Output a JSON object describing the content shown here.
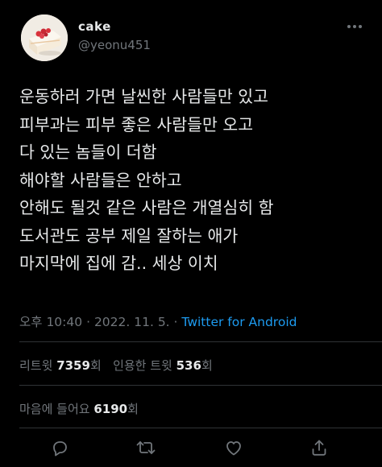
{
  "user": {
    "display_name": "cake",
    "handle": "@yeonu451"
  },
  "tweet": {
    "lines": [
      "운동하러 가면 날씬한 사람들만 있고",
      "피부과는 피부 좋은 사람들만 오고",
      "다 있는 놈들이 더함",
      "해야할 사람들은 안하고",
      "안해도 될것 같은 사람은 개열심히 함",
      "도서관도 공부 제일 잘하는 애가",
      "마지막에 집에 감.. 세상 이치"
    ]
  },
  "meta": {
    "time": "오후 10:40",
    "date": "2022. 11. 5.",
    "separator": "·",
    "source": "Twitter for Android"
  },
  "stats": {
    "retweet_label": "리트윗",
    "retweet_count": "7359",
    "retweet_unit": "회",
    "quote_label": "인용한 트윗",
    "quote_count": "536",
    "quote_unit": "회",
    "like_label": "마음에 들어요",
    "like_count": "6190",
    "like_unit": "회"
  },
  "icons": [
    "more-icon",
    "reply-icon",
    "retweet-icon",
    "like-icon",
    "share-icon"
  ],
  "colors": {
    "background": "#000000",
    "text": "#e7e9ea",
    "muted": "#71767b",
    "link": "#1d9bf0",
    "divider": "#2f3336"
  }
}
